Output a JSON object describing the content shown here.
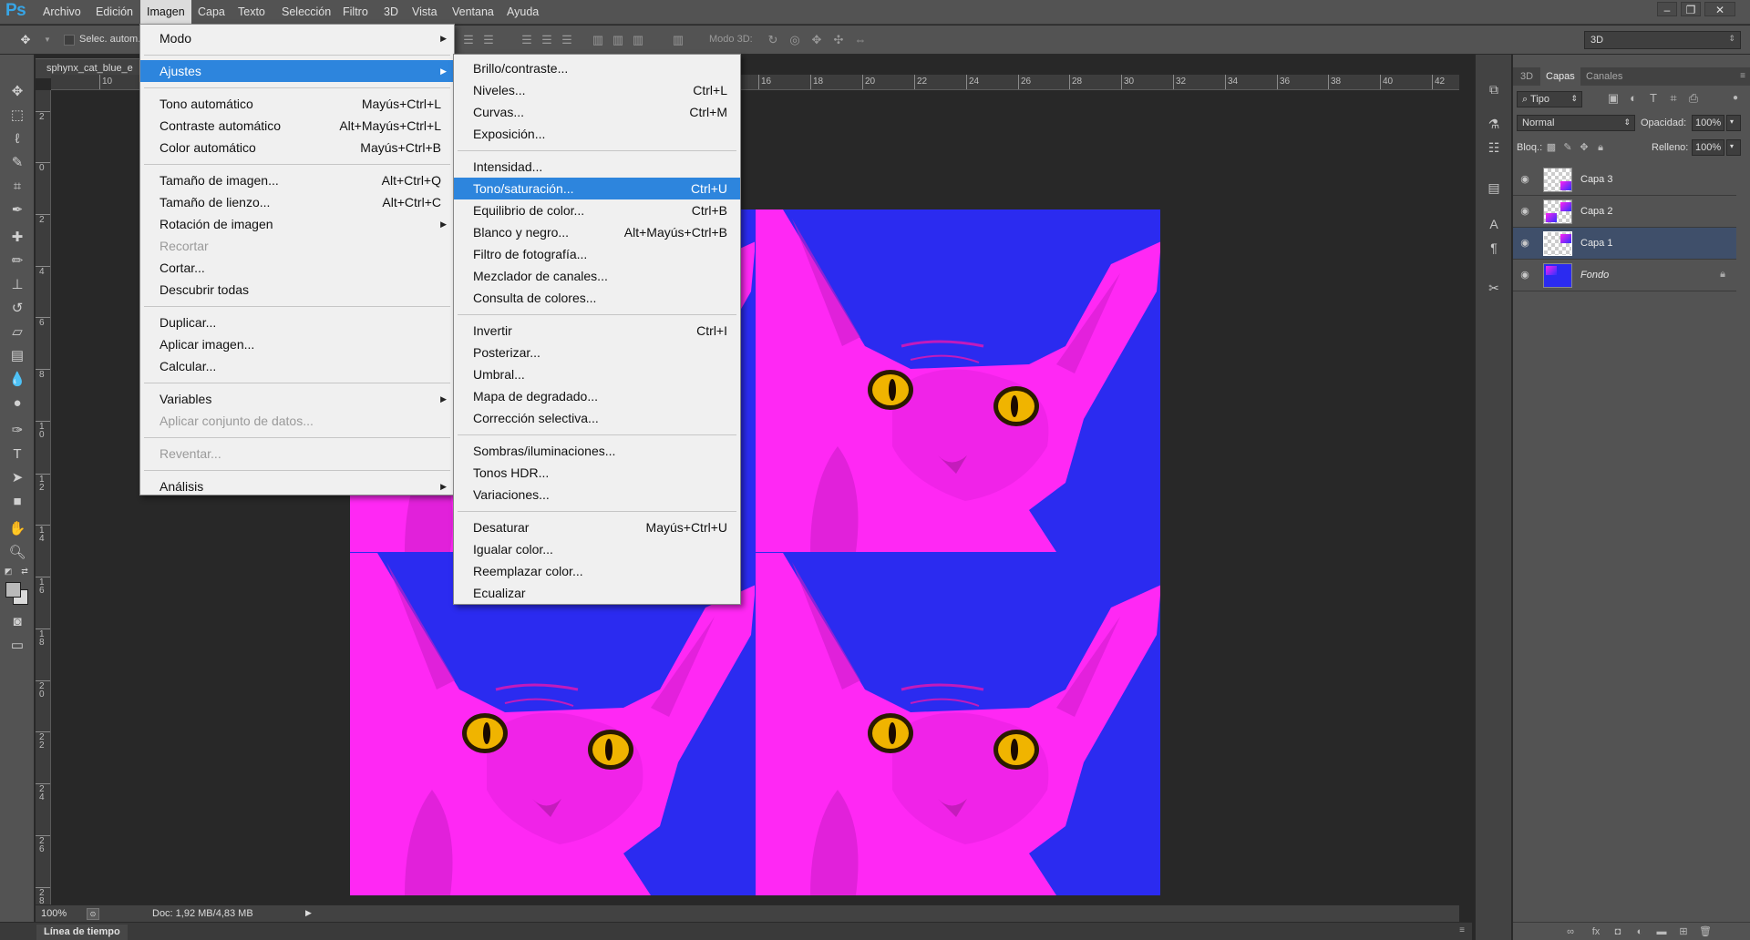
{
  "app": {
    "logo": "Ps"
  },
  "menubar": {
    "items": [
      "Archivo",
      "Edición",
      "Imagen",
      "Capa",
      "Texto",
      "Selección",
      "Filtro",
      "3D",
      "Vista",
      "Ventana",
      "Ayuda"
    ],
    "active": "Imagen"
  },
  "options": {
    "auto_select_label": "Selec. autom.",
    "mode3d_label": "Modo 3D:",
    "workspace": "3D"
  },
  "document": {
    "tab_title": "sphynx_cat_blue_e",
    "zoom": "100%",
    "doc_info": "Doc: 1,92 MB/4,83 MB",
    "ruler_top_labels": [
      "10",
      "16",
      "18",
      "20",
      "22",
      "24",
      "26",
      "28",
      "30",
      "32",
      "34",
      "36",
      "38",
      "40",
      "42"
    ],
    "ruler_left_labels": [
      "2",
      "0",
      "2",
      "4",
      "6",
      "8",
      "1 0",
      "1 2",
      "1 4",
      "1 6",
      "1 8",
      "2 0",
      "2 2",
      "2 4",
      "2 6",
      "2 8"
    ],
    "canvas_colors": {
      "background": "#2b2bf0",
      "cat": "#ff28f4",
      "eyes": "#f0b400"
    }
  },
  "timeline": {
    "label": "Línea de tiempo"
  },
  "image_menu": {
    "items": [
      {
        "label": "Modo",
        "shortcut": "",
        "submenu": true
      },
      {
        "sep": true
      },
      {
        "label": "Ajustes",
        "shortcut": "",
        "submenu": true,
        "highlight": true
      },
      {
        "sep": true
      },
      {
        "label": "Tono automático",
        "shortcut": "Mayús+Ctrl+L"
      },
      {
        "label": "Contraste automático",
        "shortcut": "Alt+Mayús+Ctrl+L"
      },
      {
        "label": "Color automático",
        "shortcut": "Mayús+Ctrl+B"
      },
      {
        "sep": true
      },
      {
        "label": "Tamaño de imagen...",
        "shortcut": "Alt+Ctrl+Q"
      },
      {
        "label": "Tamaño de lienzo...",
        "shortcut": "Alt+Ctrl+C"
      },
      {
        "label": "Rotación de imagen",
        "shortcut": "",
        "submenu": true
      },
      {
        "label": "Recortar",
        "shortcut": "",
        "disabled": true
      },
      {
        "label": "Cortar...",
        "shortcut": ""
      },
      {
        "label": "Descubrir todas",
        "shortcut": ""
      },
      {
        "sep": true
      },
      {
        "label": "Duplicar...",
        "shortcut": ""
      },
      {
        "label": "Aplicar imagen...",
        "shortcut": ""
      },
      {
        "label": "Calcular...",
        "shortcut": ""
      },
      {
        "sep": true
      },
      {
        "label": "Variables",
        "shortcut": "",
        "submenu": true
      },
      {
        "label": "Aplicar conjunto de datos...",
        "shortcut": "",
        "disabled": true
      },
      {
        "sep": true
      },
      {
        "label": "Reventar...",
        "shortcut": "",
        "disabled": true
      },
      {
        "sep": true
      },
      {
        "label": "Análisis",
        "shortcut": "",
        "submenu": true
      }
    ]
  },
  "adjust_menu": {
    "items": [
      {
        "label": "Brillo/contraste...",
        "shortcut": ""
      },
      {
        "label": "Niveles...",
        "shortcut": "Ctrl+L"
      },
      {
        "label": "Curvas...",
        "shortcut": "Ctrl+M"
      },
      {
        "label": "Exposición...",
        "shortcut": ""
      },
      {
        "sep": true
      },
      {
        "label": "Intensidad...",
        "shortcut": ""
      },
      {
        "label": "Tono/saturación...",
        "shortcut": "Ctrl+U",
        "highlight": true
      },
      {
        "label": "Equilibrio de color...",
        "shortcut": "Ctrl+B"
      },
      {
        "label": "Blanco y negro...",
        "shortcut": "Alt+Mayús+Ctrl+B"
      },
      {
        "label": "Filtro de fotografía...",
        "shortcut": ""
      },
      {
        "label": "Mezclador de canales...",
        "shortcut": ""
      },
      {
        "label": "Consulta de colores...",
        "shortcut": ""
      },
      {
        "sep": true
      },
      {
        "label": "Invertir",
        "shortcut": "Ctrl+I"
      },
      {
        "label": "Posterizar...",
        "shortcut": ""
      },
      {
        "label": "Umbral...",
        "shortcut": ""
      },
      {
        "label": "Mapa de degradado...",
        "shortcut": ""
      },
      {
        "label": "Corrección selectiva...",
        "shortcut": ""
      },
      {
        "sep": true
      },
      {
        "label": "Sombras/iluminaciones...",
        "shortcut": ""
      },
      {
        "label": "Tonos HDR...",
        "shortcut": ""
      },
      {
        "label": "Variaciones...",
        "shortcut": ""
      },
      {
        "sep": true
      },
      {
        "label": "Desaturar",
        "shortcut": "Mayús+Ctrl+U"
      },
      {
        "label": "Igualar color...",
        "shortcut": ""
      },
      {
        "label": "Reemplazar color...",
        "shortcut": ""
      },
      {
        "label": "Ecualizar",
        "shortcut": ""
      }
    ]
  },
  "layers_panel": {
    "tabs": [
      "3D",
      "Capas",
      "Canales"
    ],
    "active_tab": "Capas",
    "filter_label": "Tipo",
    "blend_mode": "Normal",
    "opacity_label": "Opacidad:",
    "opacity_value": "100%",
    "lock_label": "Bloq.:",
    "fill_label": "Relleno:",
    "fill_value": "100%",
    "layers": [
      {
        "name": "Capa 3",
        "selected": false,
        "locked": false
      },
      {
        "name": "Capa 2",
        "selected": false,
        "locked": false
      },
      {
        "name": "Capa 1",
        "selected": true,
        "locked": false
      },
      {
        "name": "Fondo",
        "selected": false,
        "locked": true
      }
    ]
  },
  "colors": {
    "menu_highlight": "#2d85dd",
    "ps_blue": "#37a5e6"
  }
}
